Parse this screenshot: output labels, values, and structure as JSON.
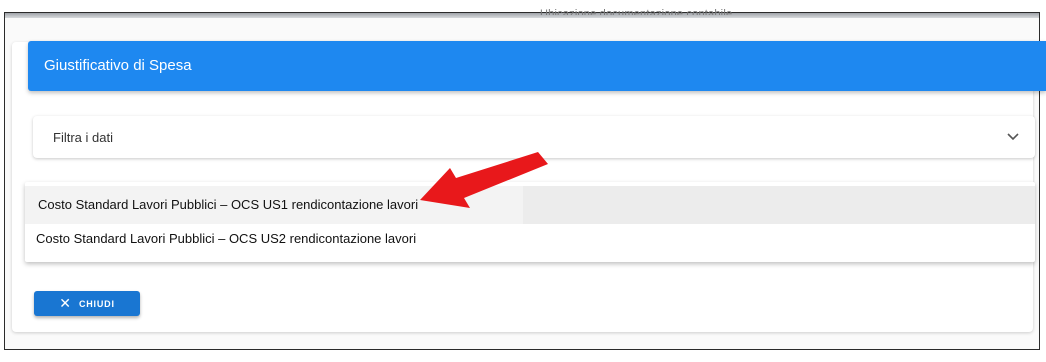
{
  "page": {
    "cut_heading": "Ubicazione documentazione contabile"
  },
  "header": {
    "title": "Giustificativo di Spesa"
  },
  "filter": {
    "label": "Filtra i dati",
    "icon": "chevron-down-icon"
  },
  "dropdown": {
    "options": [
      "Costo Standard Lavori Pubblici – OCS US1 rendicontazione lavori",
      "Costo Standard Lavori Pubblici – OCS US2 rendicontazione lavori"
    ],
    "highlighted_index": 0
  },
  "actions": {
    "close_label": "CHIUDI",
    "close_icon": "close-icon"
  },
  "annotation": {
    "arrow_color": "#e8181b",
    "icon": "red-arrow-annotation"
  },
  "colors": {
    "header_bg": "#1e88f0",
    "button_bg": "#1976d2"
  }
}
